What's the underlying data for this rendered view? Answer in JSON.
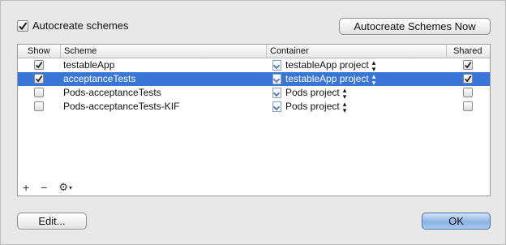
{
  "autocreate": {
    "label": "Autocreate schemes",
    "checked": true
  },
  "buttons": {
    "autocreate_now": "Autocreate Schemes Now",
    "edit": "Edit...",
    "ok": "OK"
  },
  "table": {
    "columns": [
      "Show",
      "Scheme",
      "Container",
      "Shared"
    ],
    "rows": [
      {
        "show": true,
        "scheme": "testableApp",
        "container": "testableApp project",
        "shared": true,
        "selected": false
      },
      {
        "show": true,
        "scheme": "acceptanceTests",
        "container": "testableApp project",
        "shared": true,
        "selected": true
      },
      {
        "show": false,
        "scheme": "Pods-acceptanceTests",
        "container": "Pods project",
        "shared": false,
        "selected": false
      },
      {
        "show": false,
        "scheme": "Pods-acceptanceTests-KIF",
        "container": "Pods project",
        "shared": false,
        "selected": false
      }
    ]
  },
  "toolbar": {
    "add": "+",
    "remove": "−",
    "gear": "⚙",
    "gear_arrow": "▾"
  },
  "colors": {
    "selection": "#3875d7",
    "ok_button": "#8db3e6"
  }
}
